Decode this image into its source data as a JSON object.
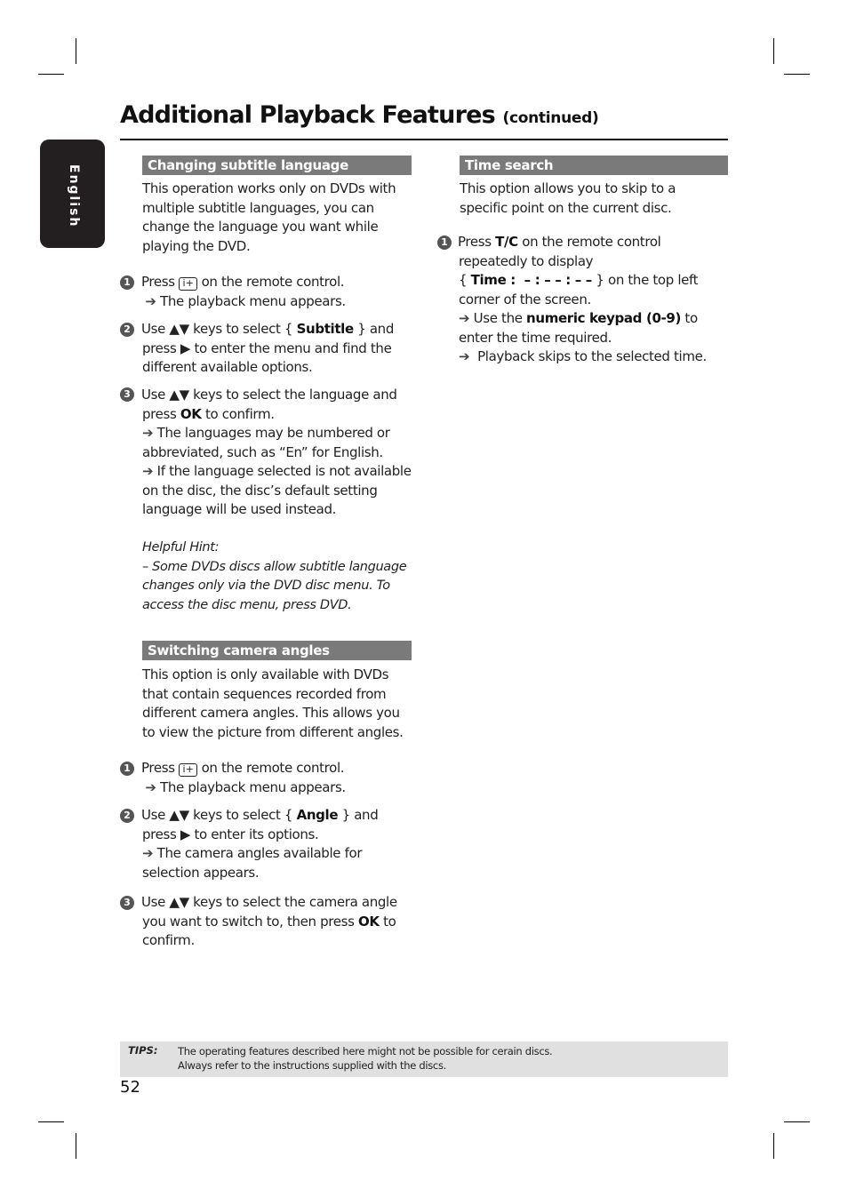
{
  "page": {
    "title": "Additional Playback Features",
    "title_suffix": "(continued)",
    "language_tab": "English",
    "page_number": "52"
  },
  "subtitle_section": {
    "heading": "Changing subtitle language",
    "intro": [
      "This operation works only on DVDs with",
      "multiple subtitle languages, you can",
      "change the language you want while",
      "playing the DVD."
    ],
    "step1": {
      "num": "1",
      "pre": "Press",
      "icon_label": "i+",
      "post": "on the remote control.",
      "result": "The playback menu appears."
    },
    "step2": {
      "num": "2",
      "line1_pre": "Use ▲▼ keys to select {",
      "line1_bold": "Subtitle",
      "line1_post": "} and",
      "line2": "press ▶ to enter the menu and find the",
      "line3": "different available options."
    },
    "step3": {
      "num": "3",
      "line1": "Use ▲▼ keys to select the language and",
      "line2_pre": "press",
      "line2_bold": "OK",
      "line2_post": "to confirm.",
      "note1_a": "The languages may be numbered or",
      "note1_b": "abbreviated, such as “En” for English.",
      "note2_a": "If the language selected is not available",
      "note2_b": "on the disc, the disc’s default setting",
      "note2_c": "language will be used instead."
    },
    "hint": {
      "title": "Helpful Hint:",
      "lines": [
        "– Some DVDs discs allow subtitle language",
        "changes only via the DVD disc menu. To",
        "access the disc menu, press DVD."
      ]
    }
  },
  "angle_section": {
    "heading": "Switching camera angles",
    "intro": [
      "This option is only available with DVDs",
      "that contain sequences recorded from",
      "different camera angles. This allows you",
      "to view the picture from different angles."
    ],
    "step1": {
      "num": "1",
      "pre": "Press",
      "icon_label": "i+",
      "post": "on the remote control.",
      "result": "The playback menu appears."
    },
    "step2": {
      "num": "2",
      "line1_pre": "Use ▲▼ keys to select {",
      "line1_bold": "Angle",
      "line1_post": "} and",
      "line2": "press ▶ to enter its options.",
      "note_a": "The camera angles available for",
      "note_b": "selection appears."
    },
    "step3": {
      "num": "3",
      "line1": "Use ▲▼ keys to select the camera angle",
      "line2_pre": "you want to switch to, then press",
      "line2_bold": "OK",
      "line2_post": "to",
      "line3": "confirm."
    }
  },
  "time_section": {
    "heading": "Time search",
    "intro": [
      "This option allows you to skip to a",
      "specific point on the current disc."
    ],
    "step1": {
      "num": "1",
      "line1_pre": "Press",
      "line1_bold": "T/C",
      "line1_post": "on the remote control",
      "line2": "repeatedly to display",
      "line3_open": "{",
      "line3_bold": "Time :  – : – – : – –",
      "line3_post": "} on the top left",
      "line4": "corner of the screen.",
      "note1_pre": "Use the",
      "note1_bold": "numeric keypad (0-9)",
      "note1_post": "to",
      "note1_b": "enter the time required.",
      "note2": "Playback skips to the selected time."
    }
  },
  "tips": {
    "label": "TIPS:",
    "line1": "The operating features described here might not be possible for cerain discs.",
    "line2": "Always refer to the instructions supplied with the discs."
  },
  "arrow_glyph": "➔"
}
